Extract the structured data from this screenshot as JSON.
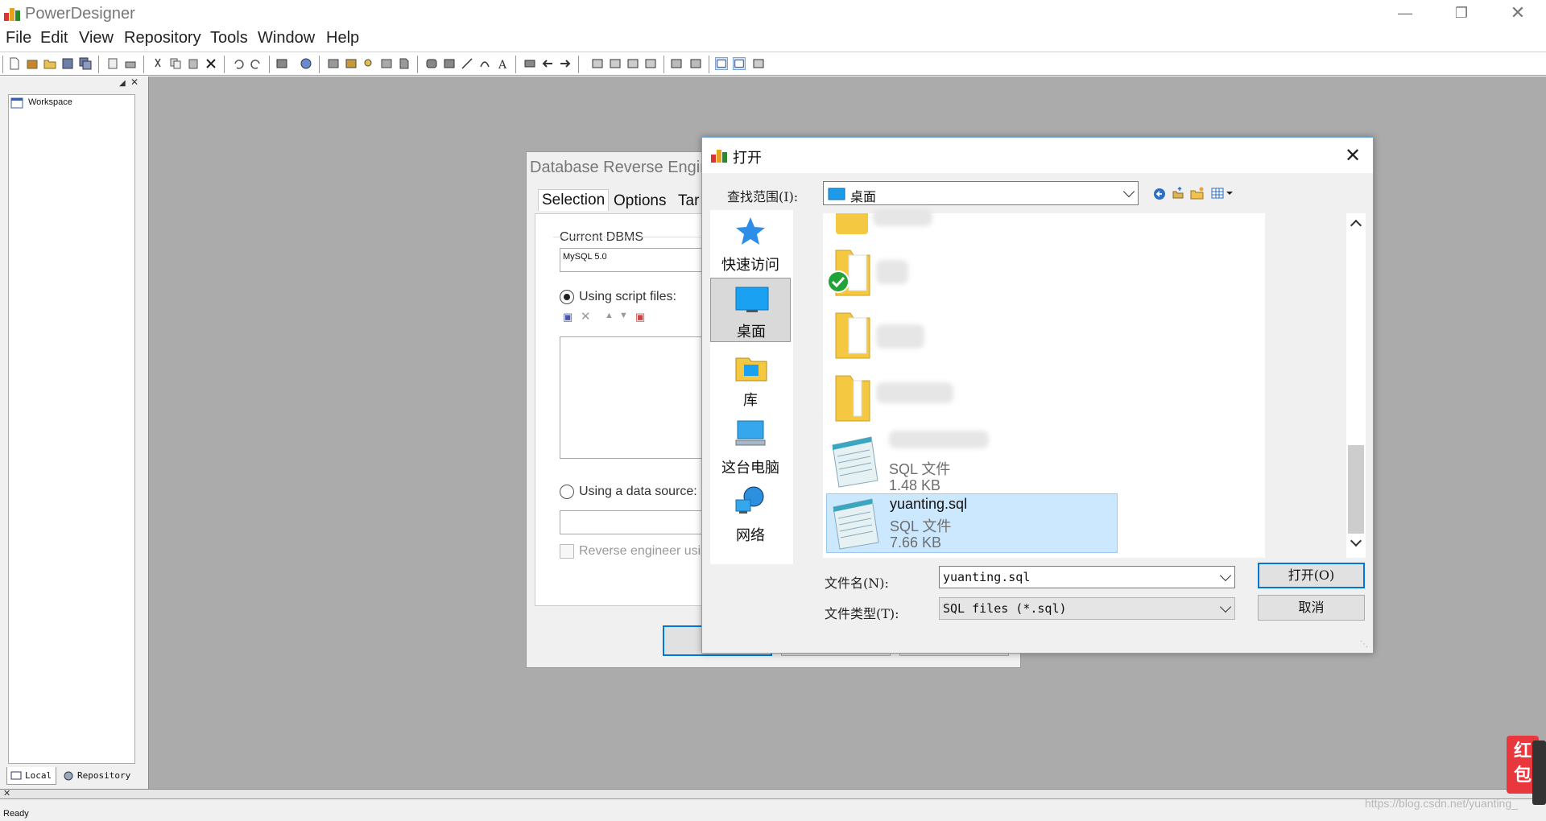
{
  "app": {
    "title": "PowerDesigner"
  },
  "menu": [
    "File",
    "Edit",
    "View",
    "Repository",
    "Tools",
    "Window",
    "Help"
  ],
  "left_panel": {
    "tree_root": "Workspace",
    "tabs": [
      "Local",
      "Repository"
    ]
  },
  "status": {
    "text": "Ready"
  },
  "db_dialog": {
    "title": "Database Reverse Engine",
    "tabs": [
      "Selection",
      "Options",
      "Tar"
    ],
    "current_dbms_label": "Current DBMS",
    "current_dbms_value": "MySQL 5.0",
    "script_files_label": "Using script files:",
    "data_source_label": "Using a data source:",
    "reverse_label": "Reverse engineer usin"
  },
  "open_dialog": {
    "title": "打开",
    "look_in_label": "查找范围(I):",
    "look_in_value": "桌面",
    "places": [
      {
        "label": "快速访问",
        "icon": "star-icon"
      },
      {
        "label": "桌面",
        "icon": "desktop-icon"
      },
      {
        "label": "库",
        "icon": "library-icon"
      },
      {
        "label": "这台电脑",
        "icon": "computer-icon"
      },
      {
        "label": "网络",
        "icon": "network-icon"
      }
    ],
    "files": [
      {
        "name": "",
        "type": "SQL 文件",
        "size": "1.48 KB"
      },
      {
        "name": "yuanting.sql",
        "type": "SQL 文件",
        "size": "7.66 KB"
      }
    ],
    "filename_label": "文件名(N):",
    "filename_value": "yuanting.sql",
    "filetype_label": "文件类型(T):",
    "filetype_value": "SQL files (*.sql)",
    "open_button": "打开(O)",
    "cancel_button": "取消"
  },
  "badge": {
    "text1": "红",
    "text2": "包"
  },
  "watermark": "https://blog.csdn.net/yuanting_"
}
